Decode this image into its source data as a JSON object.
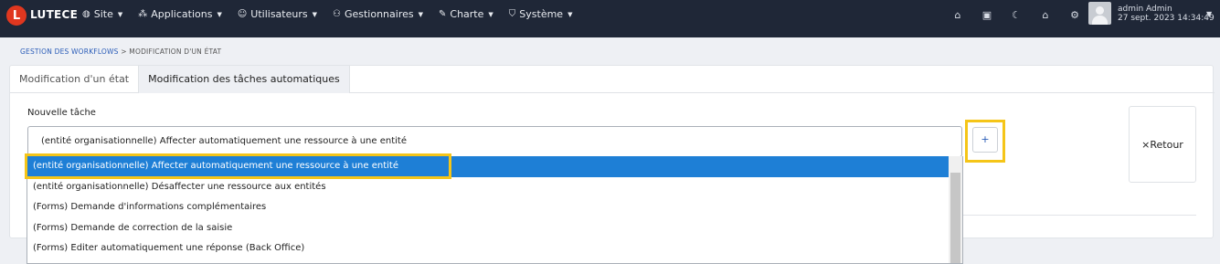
{
  "brand": {
    "name": "LUTECE",
    "logo_letter": "L"
  },
  "menu": [
    {
      "icon": "globe-icon",
      "glyph": "◍",
      "label": "Site"
    },
    {
      "icon": "grid-icon",
      "glyph": "⁂",
      "label": "Applications"
    },
    {
      "icon": "users-icon",
      "glyph": "☺",
      "label": "Utilisateurs"
    },
    {
      "icon": "user-gear-icon",
      "glyph": "⚇",
      "label": "Gestionnaires"
    },
    {
      "icon": "brush-icon",
      "glyph": "✎",
      "label": "Charte"
    },
    {
      "icon": "shield-icon",
      "glyph": "⛉",
      "label": "Système"
    }
  ],
  "right_icons": [
    {
      "icon": "home-icon",
      "glyph": "⌂"
    },
    {
      "icon": "layout-icon",
      "glyph": "▣"
    },
    {
      "icon": "moon-icon",
      "glyph": "☾"
    },
    {
      "icon": "home-alt-icon",
      "glyph": "⌂"
    },
    {
      "icon": "gear-icon",
      "glyph": "⚙"
    }
  ],
  "user": {
    "name": "admin Admin",
    "datetime": "27 sept. 2023 14:34:49"
  },
  "breadcrumb": {
    "parent": "GESTION DES WORKFLOWS",
    "separator": ">",
    "current": "MODIFICATION D'UN ÉTAT"
  },
  "tabs": [
    {
      "label": "Modification d'un état",
      "active": false
    },
    {
      "label": "Modification des tâches automatiques",
      "active": true
    }
  ],
  "form": {
    "label": "Nouvelle tâche",
    "selected_value": "(entité organisationnelle) Affecter automatiquement une ressource à une entité",
    "add_label": "+",
    "back_label": "Retour",
    "back_icon": "×"
  },
  "dropdown_options": [
    "(entité organisationnelle) Affecter automatiquement une ressource à une entité",
    "(entité organisationnelle) Désaffecter une ressource aux entités",
    "(Forms) Demande d'informations complémentaires",
    "(Forms) Demande de correction de la saisie",
    "(Forms) Editer automatiquement une réponse (Back Office)"
  ],
  "colors": {
    "navbar": "#1f2737",
    "accent": "#1e7fd6",
    "highlight": "#f5c518",
    "logo": "#e0371f"
  }
}
